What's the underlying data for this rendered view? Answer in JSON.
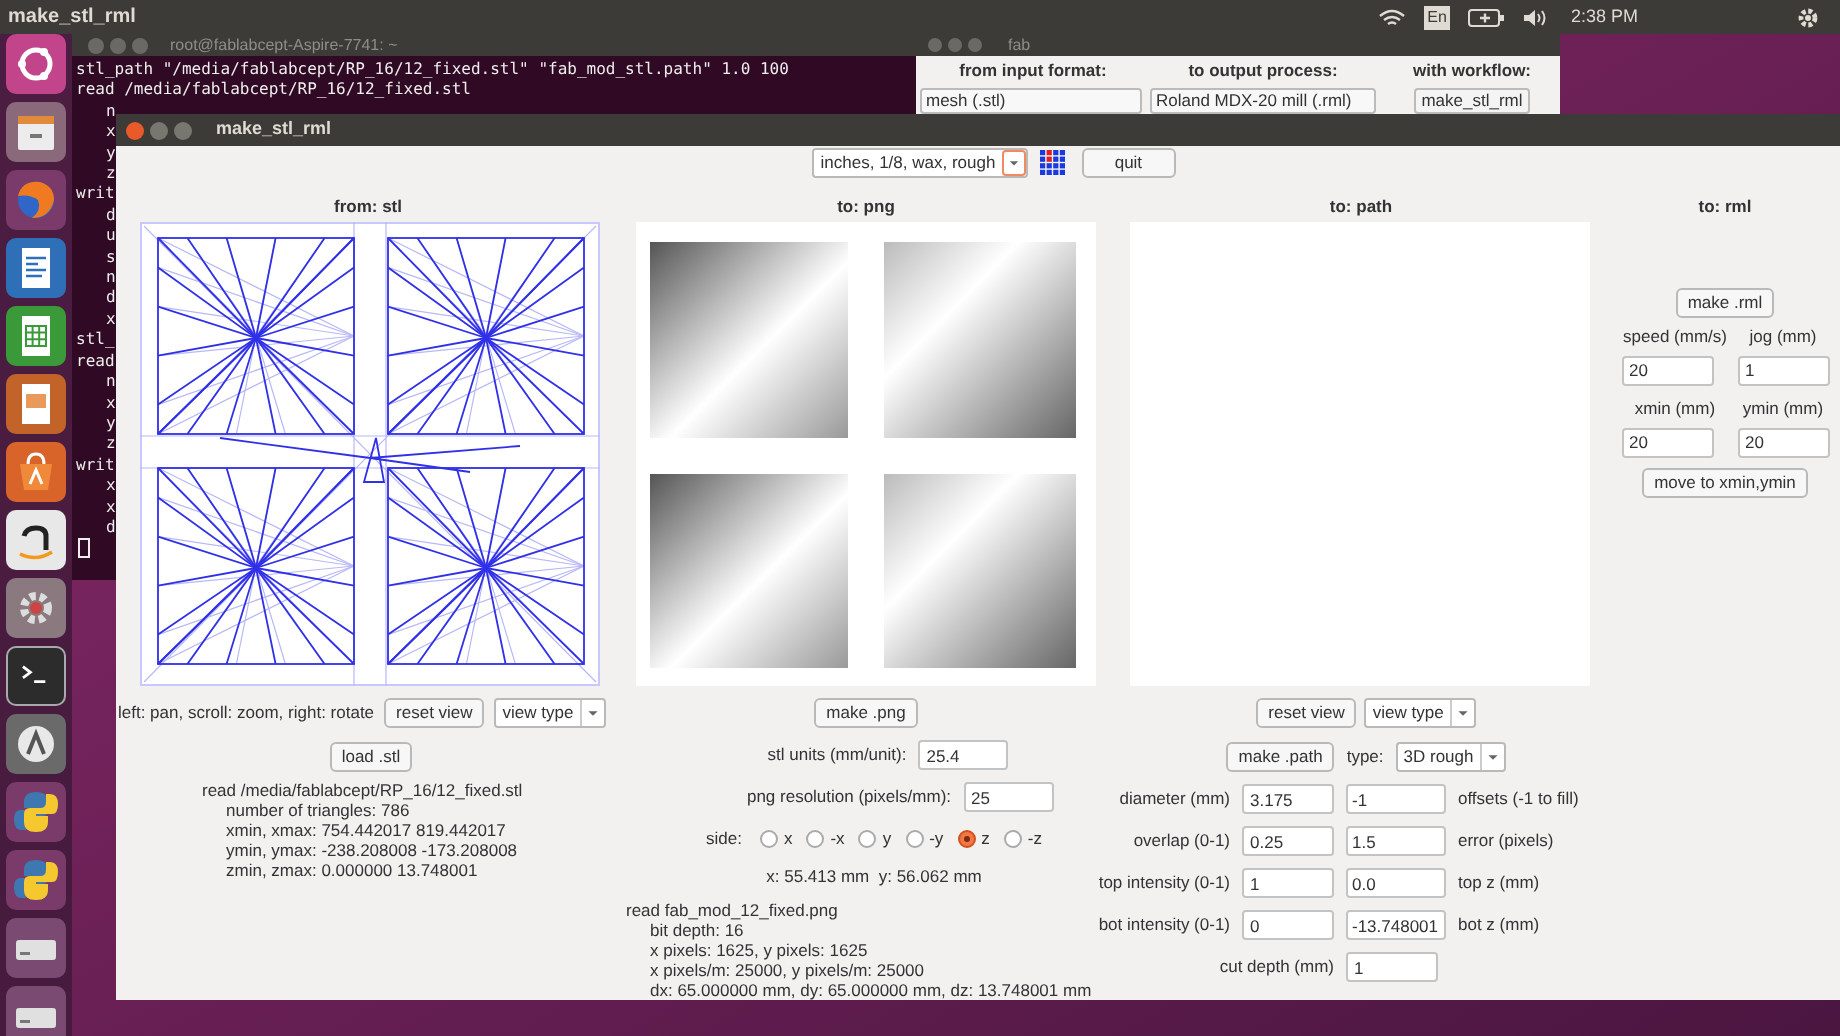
{
  "top_bar": {
    "title": "make_stl_rml",
    "keyboard": "En",
    "time": "2:38 PM"
  },
  "launcher": [
    {
      "kind": "ubuntu"
    },
    {
      "kind": "files"
    },
    {
      "kind": "firefox"
    },
    {
      "kind": "writer"
    },
    {
      "kind": "calc"
    },
    {
      "kind": "impress"
    },
    {
      "kind": "software"
    },
    {
      "kind": "amazon"
    },
    {
      "kind": "settings"
    },
    {
      "kind": "terminal"
    },
    {
      "kind": "updates"
    },
    {
      "kind": "python"
    },
    {
      "kind": "python"
    },
    {
      "kind": "drive"
    },
    {
      "kind": "drive"
    }
  ],
  "terminal": {
    "title": "root@fablabcept-Aspire-7741: ~",
    "lines": [
      {
        "text": "stl_path \"/media/fablabcept/RP_16/12_fixed.stl\" \"fab_mod_stl.path\" 1.0 100"
      },
      {
        "text": "read /media/fablabcept/RP_16/12_fixed.stl",
        "children": [
          {
            "text": "n"
          },
          {
            "text": "x"
          },
          {
            "text": "y"
          },
          {
            "text": "z"
          }
        ]
      },
      {
        "text": "writ",
        "children": [
          {
            "text": "d"
          },
          {
            "text": "u"
          },
          {
            "text": "s"
          },
          {
            "text": "n"
          },
          {
            "text": "d"
          },
          {
            "text": "x"
          }
        ]
      },
      {
        "text": "stl_"
      },
      {
        "text": "read",
        "children": [
          {
            "text": "n"
          },
          {
            "text": "x"
          },
          {
            "text": "y"
          },
          {
            "text": "z"
          }
        ]
      },
      {
        "text": "writ",
        "children": [
          {
            "text": "x"
          },
          {
            "text": "x"
          },
          {
            "text": "d"
          }
        ]
      }
    ]
  },
  "fab_window": {
    "title": "fab",
    "headings": [
      "from input format:",
      "to output process:",
      "with workflow:"
    ],
    "input_format": "mesh (.stl)",
    "output_process": "Roland MDX-20 mill (.rml)",
    "workflow_button": "make_stl_rml"
  },
  "main_window": {
    "title": "make_stl_rml",
    "settings_dropdown": "inches, 1/8, wax, rough",
    "quit_button": "quit",
    "stl": {
      "heading": "from: stl",
      "hint": "left: pan, scroll: zoom, right: rotate",
      "reset_button": "reset view",
      "view_dropdown": "view type",
      "load_button": "load .stl",
      "log": {
        "text": "read /media/fablabcept/RP_16/12_fixed.stl",
        "children": [
          "number of triangles: 786",
          "xmin, xmax: 754.442017 819.442017",
          "ymin, ymax: -238.208008 -173.208008",
          "zmin, zmax: 0.000000 13.748001"
        ]
      }
    },
    "png": {
      "heading": "to: png",
      "make_button": "make .png",
      "fields": [
        {
          "label": "stl units (mm/unit):",
          "value": "25.4"
        },
        {
          "label": "png resolution (pixels/mm):",
          "value": "25"
        }
      ],
      "side": {
        "label": "side:",
        "options": [
          {
            "label": "x",
            "selected": false
          },
          {
            "label": "-x",
            "selected": false
          },
          {
            "label": "y",
            "selected": false
          },
          {
            "label": "-y",
            "selected": false
          },
          {
            "label": "z",
            "selected": true
          },
          {
            "label": "-z",
            "selected": false
          }
        ]
      },
      "size": "x: 55.413 mm  y: 56.062 mm",
      "log": {
        "text": "read fab_mod_12_fixed.png",
        "children": [
          "bit depth: 16",
          "x pixels: 1625, y pixels: 1625",
          "x pixels/m: 25000, y pixels/m: 25000",
          "dx: 65.000000 mm, dy: 65.000000 mm, dz: 13.748001 mm"
        ]
      }
    },
    "path": {
      "heading": "to: path",
      "reset_button": "reset view",
      "view_dropdown": "view type",
      "make_button": "make .path",
      "type_label": "type:",
      "type_value": "3D rough",
      "rows": [
        {
          "label": "diameter (mm)",
          "value": "3.175",
          "value_2": "-1",
          "label_2": "offsets (-1 to fill)"
        },
        {
          "label": "overlap (0-1)",
          "value": "0.25",
          "value_2": "1.5",
          "label_2": "error (pixels)"
        },
        {
          "label": "top intensity (0-1)",
          "value": "1",
          "value_2": "0.0",
          "label_2": "top z (mm)"
        },
        {
          "label": "bot intensity (0-1)",
          "value": "0",
          "value_2": "-13.748001",
          "label_2": "bot z (mm)"
        }
      ],
      "cut_depth": {
        "label": "cut depth (mm)",
        "value": "1"
      }
    },
    "rml": {
      "heading": "to: rml",
      "make_button": "make .rml",
      "fields": [
        {
          "label": "speed (mm/s)",
          "value": "20"
        },
        {
          "label": "jog (mm)",
          "value": "1"
        },
        {
          "label": "xmin (mm)",
          "value": "20"
        },
        {
          "label": "ymin (mm)",
          "value": "20"
        }
      ],
      "move_button": "move to xmin,ymin"
    }
  }
}
